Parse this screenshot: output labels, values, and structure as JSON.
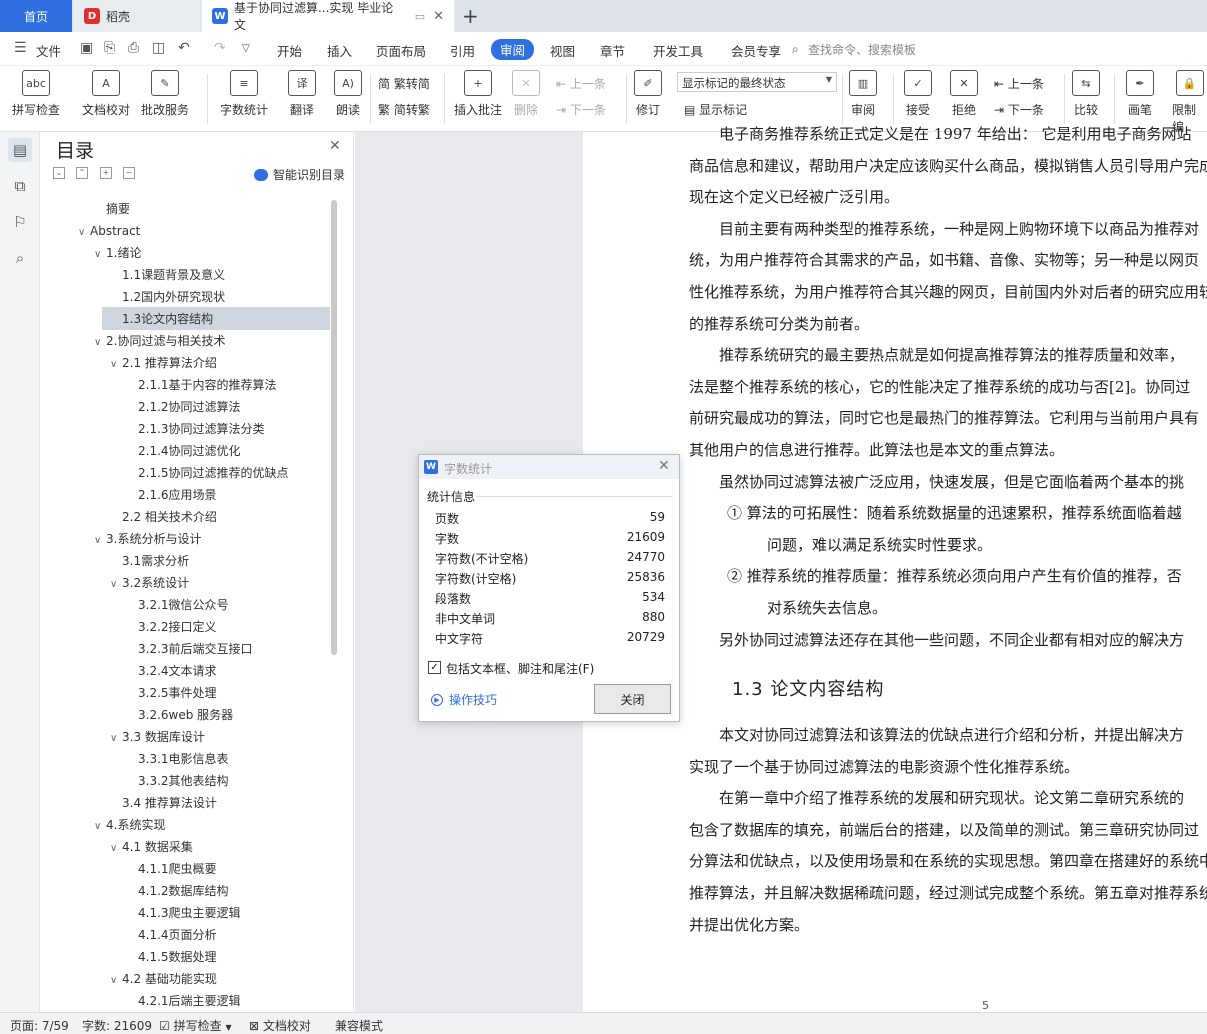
{
  "tabs": {
    "home": "首页",
    "daoke": "稻壳",
    "doc": "基于协同过滤算...实现 毕业论文"
  },
  "menu": {
    "file": "文件",
    "items": [
      "开始",
      "插入",
      "页面布局",
      "引用",
      "审阅",
      "视图",
      "章节",
      "开发工具",
      "会员专享"
    ],
    "active": "审阅",
    "search": "查找命令、搜索模板"
  },
  "ribbon": {
    "spell": "拼写检查",
    "doc_check": "文档校对",
    "batch": "批改服务",
    "word_count": "字数统计",
    "translate": "翻译",
    "read": "朗读",
    "trad_to_simp": "繁转简",
    "simp_to_trad": "简转繁",
    "insert_comment": "插入批注",
    "delete": "删除",
    "prev": "上一条",
    "next": "下一条",
    "revise": "修订",
    "markup_state": "显示标记的最终状态",
    "show_markup": "显示标记",
    "review": "审阅",
    "accept": "接受",
    "reject": "拒绝",
    "prev2": "上一条",
    "next2": "下一条",
    "compare": "比较",
    "pen": "画笔",
    "restrict": "限制编"
  },
  "toc": {
    "title": "目录",
    "smart": "智能识别目录",
    "items": [
      {
        "label": "摘要",
        "level": 1,
        "arrow": ""
      },
      {
        "label": "Abstract",
        "level": 0,
        "arrow": "v"
      },
      {
        "label": "1.绪论",
        "level": 1,
        "arrow": "v"
      },
      {
        "label": "1.1课题背景及意义",
        "level": 2,
        "arrow": ""
      },
      {
        "label": "1.2国内外研究现状",
        "level": 2,
        "arrow": ""
      },
      {
        "label": "1.3论文内容结构",
        "level": 2,
        "arrow": ""
      },
      {
        "label": "2.协同过滤与相关技术",
        "level": 1,
        "arrow": "v"
      },
      {
        "label": "2.1 推荐算法介绍",
        "level": 2,
        "arrow": "v"
      },
      {
        "label": "2.1.1基于内容的推荐算法",
        "level": 3,
        "arrow": ""
      },
      {
        "label": "2.1.2协同过滤算法",
        "level": 3,
        "arrow": ""
      },
      {
        "label": "2.1.3协同过滤算法分类",
        "level": 3,
        "arrow": ""
      },
      {
        "label": "2.1.4协同过滤优化",
        "level": 3,
        "arrow": ""
      },
      {
        "label": "2.1.5协同过滤推荐的优缺点",
        "level": 3,
        "arrow": ""
      },
      {
        "label": "2.1.6应用场景",
        "level": 3,
        "arrow": ""
      },
      {
        "label": "2.2 相关技术介绍",
        "level": 2,
        "arrow": ""
      },
      {
        "label": "3.系统分析与设计",
        "level": 1,
        "arrow": "v"
      },
      {
        "label": "3.1需求分析",
        "level": 2,
        "arrow": ""
      },
      {
        "label": "3.2系统设计",
        "level": 2,
        "arrow": "v"
      },
      {
        "label": "3.2.1微信公众号",
        "level": 3,
        "arrow": ""
      },
      {
        "label": "3.2.2接口定义",
        "level": 3,
        "arrow": ""
      },
      {
        "label": "3.2.3前后端交互接口",
        "level": 3,
        "arrow": ""
      },
      {
        "label": "3.2.4文本请求",
        "level": 3,
        "arrow": ""
      },
      {
        "label": "3.2.5事件处理",
        "level": 3,
        "arrow": ""
      },
      {
        "label": "3.2.6web 服务器",
        "level": 3,
        "arrow": ""
      },
      {
        "label": "3.3 数据库设计",
        "level": 2,
        "arrow": "v"
      },
      {
        "label": "3.3.1电影信息表",
        "level": 3,
        "arrow": ""
      },
      {
        "label": "3.3.2其他表结构",
        "level": 3,
        "arrow": ""
      },
      {
        "label": "3.4 推荐算法设计",
        "level": 2,
        "arrow": ""
      },
      {
        "label": "4.系统实现",
        "level": 1,
        "arrow": "v"
      },
      {
        "label": "4.1 数据采集",
        "level": 2,
        "arrow": "v"
      },
      {
        "label": "4.1.1爬虫概要",
        "level": 3,
        "arrow": ""
      },
      {
        "label": "4.1.2数据库结构",
        "level": 3,
        "arrow": ""
      },
      {
        "label": "4.1.3爬虫主要逻辑",
        "level": 3,
        "arrow": ""
      },
      {
        "label": "4.1.4页面分析",
        "level": 3,
        "arrow": ""
      },
      {
        "label": "4.1.5数据处理",
        "level": 3,
        "arrow": ""
      },
      {
        "label": "4.2 基础功能实现",
        "level": 2,
        "arrow": "v"
      },
      {
        "label": "4.2.1后端主要逻辑",
        "level": 3,
        "arrow": ""
      }
    ]
  },
  "document": {
    "lines": [
      {
        "t": "电子商务推荐系统正式定义是在 1997 年给出： 它是利用电子商务网站",
        "ind": true
      },
      {
        "t": "商品信息和建议，帮助用户决定应该购买什么商品，模拟销售人员引导用户完成",
        "ind": false
      },
      {
        "t": "现在这个定义已经被广泛引用。",
        "ind": false
      },
      {
        "t": "目前主要有两种类型的推荐系统，一种是网上购物环境下以商品为推荐对",
        "ind": true
      },
      {
        "t": "统，为用户推荐符合其需求的产品，如书籍、音像、实物等；另一种是以网页",
        "ind": false
      },
      {
        "t": "性化推荐系统，为用户推荐符合其兴趣的网页，目前国内外对后者的研究应用较多",
        "ind": false
      },
      {
        "t": "的推荐系统可分类为前者。",
        "ind": false
      },
      {
        "t": "推荐系统研究的最主要热点就是如何提高推荐算法的推荐质量和效率，",
        "ind": true
      },
      {
        "t": "法是整个推荐系统的核心，它的性能决定了推荐系统的成功与否[2]。协同过",
        "ind": false
      },
      {
        "t": "前研究最成功的算法，同时它也是最热门的推荐算法。它利用与当前用户具有",
        "ind": false
      },
      {
        "t": "其他用户的信息进行推荐。此算法也是本文的重点算法。",
        "ind": false
      },
      {
        "t": "虽然协同过滤算法被广泛应用，快速发展，但是它面临着两个基本的挑",
        "ind": true
      },
      {
        "t": "①   算法的可拓展性：随着系统数据量的迅速累积，推荐系统面临着越",
        "ind": "l1"
      },
      {
        "t": "问题，难以满足系统实时性要求。",
        "ind": "l2"
      },
      {
        "t": "②   推荐系统的推荐质量：推荐系统必须向用户产生有价值的推荐，否",
        "ind": "l1"
      },
      {
        "t": "对系统失去信息。",
        "ind": "l2"
      },
      {
        "t": "另外协同过滤算法还存在其他一些问题，不同企业都有相对应的解决方",
        "ind": true
      }
    ],
    "heading": "1.3 论文内容结构",
    "lines2": [
      {
        "t": "本文对协同过滤算法和该算法的优缺点进行介绍和分析，并提出解决方",
        "ind": true
      },
      {
        "t": "实现了一个基于协同过滤算法的电影资源个性化推荐系统。",
        "ind": false
      },
      {
        "t": "在第一章中介绍了推荐系统的发展和研究现状。论文第二章研究系统的",
        "ind": true
      },
      {
        "t": "包含了数据库的填充，前端后台的搭建，以及简单的测试。第三章研究协同过",
        "ind": false
      },
      {
        "t": "分算法和优缺点，以及使用场景和在系统的实现思想。第四章在搭建好的系统中",
        "ind": false
      },
      {
        "t": "推荐算法，并且解决数据稀疏问题，经过测试完成整个系统。第五章对推荐系统",
        "ind": false
      },
      {
        "t": "并提出优化方案。",
        "ind": false
      }
    ],
    "page_number": "5"
  },
  "dialog": {
    "title": "字数统计",
    "section": "统计信息",
    "stats": [
      {
        "k": "页数",
        "v": "59"
      },
      {
        "k": "字数",
        "v": "21609"
      },
      {
        "k": "字符数(不计空格)",
        "v": "24770"
      },
      {
        "k": "字符数(计空格)",
        "v": "25836"
      },
      {
        "k": "段落数",
        "v": "534"
      },
      {
        "k": "非中文单词",
        "v": "880"
      },
      {
        "k": "中文字符",
        "v": "20729"
      }
    ],
    "checkbox_label": "包括文本框、脚注和尾注(F)",
    "checkbox_checked": true,
    "tips": "操作技巧",
    "close": "关闭"
  },
  "status": {
    "page": "页面: 7/59",
    "words": "字数: 21609",
    "spell": "拼写检查",
    "doc_check": "文档校对",
    "compat": "兼容模式"
  }
}
